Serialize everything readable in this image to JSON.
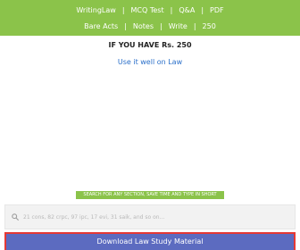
{
  "nav": {
    "primary": [
      "WritingLaw",
      "MCQ Test",
      "Q&A",
      "PDF"
    ],
    "secondary": [
      "Bare Acts",
      "Notes",
      "Write",
      "250"
    ],
    "separator": "|"
  },
  "promo": {
    "title": "IF YOU HAVE Rs. 250",
    "link_label": "Use it well on Law"
  },
  "search": {
    "caption": "SEARCH FOR ANY SECTION, SAVE TIME AND TYPE IN SHORT",
    "placeholder": "21 cons, 82 crpc, 97 ipc, 17 evi, 31 saik, and so on..."
  },
  "cta": {
    "download_label": "Download Law Study Material"
  },
  "colors": {
    "nav_bg": "#8bc34a",
    "link": "#2a6fc9",
    "button_bg": "#5c6bc0",
    "button_border": "#e53935"
  }
}
